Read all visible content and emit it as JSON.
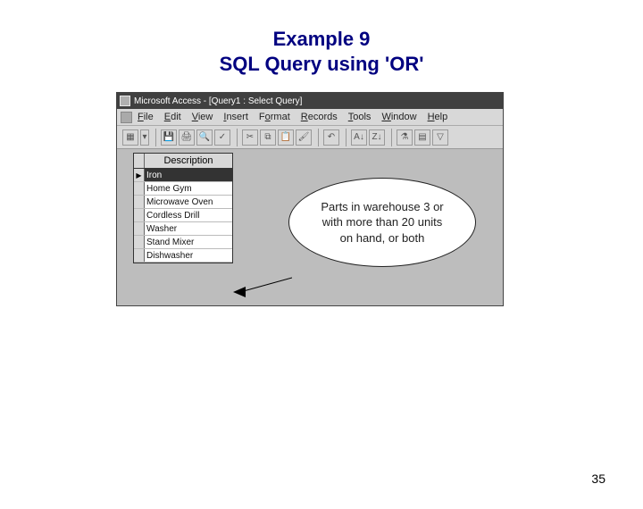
{
  "title_line1": "Example 9",
  "title_line2": "SQL Query using 'OR'",
  "window": {
    "title": "Microsoft Access - [Query1 : Select Query]"
  },
  "menu": {
    "file": "File",
    "edit": "Edit",
    "view": "View",
    "insert": "Insert",
    "format": "Format",
    "records": "Records",
    "tools": "Tools",
    "window": "Window",
    "help": "Help"
  },
  "datasheet": {
    "column": "Description",
    "rows": [
      "Iron",
      "Home Gym",
      "Microwave Oven",
      "Cordless Drill",
      "Washer",
      "Stand Mixer",
      "Dishwasher"
    ]
  },
  "callout": {
    "line1": "Parts in warehouse 3 or",
    "line2": "with more than 20 units",
    "line3": "on hand, or both"
  },
  "page_number": "35"
}
